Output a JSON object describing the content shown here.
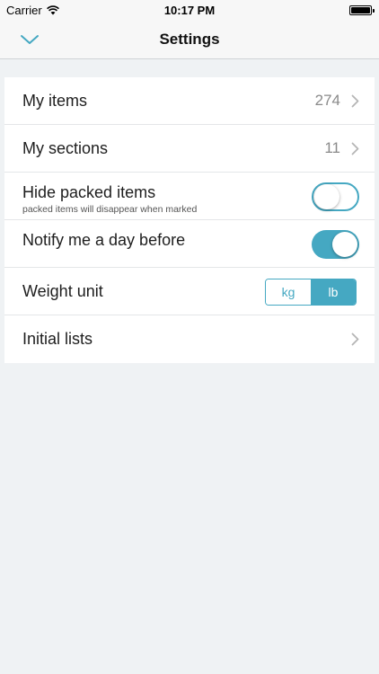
{
  "status_bar": {
    "carrier": "Carrier",
    "time": "10:17 PM"
  },
  "nav": {
    "title": "Settings",
    "back_icon": "chevron-down-icon"
  },
  "settings": {
    "my_items": {
      "label": "My items",
      "value": "274"
    },
    "my_sections": {
      "label": "My sections",
      "value": "11"
    },
    "hide_packed": {
      "label": "Hide packed items",
      "subtitle": "packed items will disappear when marked",
      "enabled": false
    },
    "notify": {
      "label": "Notify me a day before",
      "enabled": true
    },
    "weight_unit": {
      "label": "Weight unit",
      "options": [
        "kg",
        "lb"
      ],
      "selected": "lb"
    },
    "initial_lists": {
      "label": "Initial lists"
    }
  },
  "colors": {
    "accent": "#45a8c2",
    "background": "#eff2f4",
    "bar": "#f7f7f7"
  }
}
